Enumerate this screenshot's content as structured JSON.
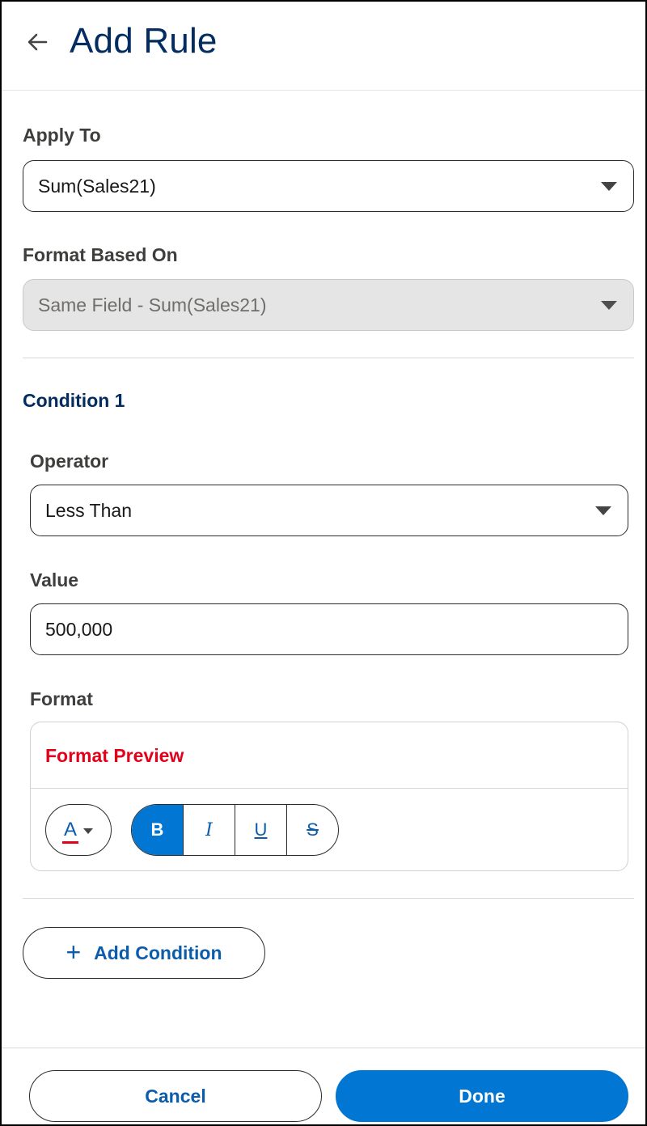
{
  "header": {
    "title": "Add Rule",
    "back_icon": "arrow-left-icon"
  },
  "apply_to": {
    "label": "Apply To",
    "selected": "Sum(Sales21)"
  },
  "format_based_on": {
    "label": "Format Based On",
    "selected": "Same Field - Sum(Sales21)",
    "disabled": true
  },
  "condition": {
    "title": "Condition 1",
    "operator": {
      "label": "Operator",
      "selected": "Less Than"
    },
    "value": {
      "label": "Value",
      "current": "500,000"
    },
    "format": {
      "label": "Format",
      "preview_text": "Format Preview",
      "preview_color": "#e3001b",
      "color_glyph": "A",
      "style_buttons": [
        {
          "glyph": "B",
          "name": "bold",
          "active": true
        },
        {
          "glyph": "I",
          "name": "italic",
          "active": false
        },
        {
          "glyph": "U",
          "name": "underline",
          "active": false
        },
        {
          "glyph": "S",
          "name": "strikethrough",
          "active": false
        }
      ]
    }
  },
  "add_condition": {
    "label": "Add Condition",
    "icon": "plus-icon"
  },
  "footer": {
    "cancel_label": "Cancel",
    "done_label": "Done"
  },
  "colors": {
    "accent": "#0176d3",
    "title": "#032d60",
    "link": "#0b5cab",
    "preview_red": "#e3001b"
  }
}
